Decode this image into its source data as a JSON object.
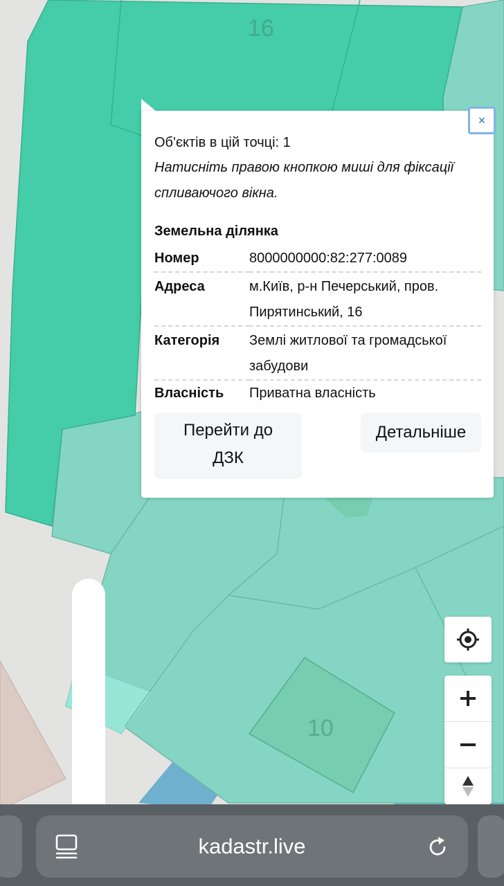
{
  "map": {
    "parcel_labels": [
      "16",
      "10"
    ]
  },
  "popup": {
    "close_label": "×",
    "objects_count": "Об'єктів в цій точці: 1",
    "hint": "Натисніть правою кнопкою миші для фіксації спливаючого вікна.",
    "section_title": "Земельна ділянка",
    "fields": [
      {
        "key": "Номер",
        "value": "8000000000:82:277:0089"
      },
      {
        "key": "Адреса",
        "value": "м.Київ, р-н Печерський, пров. Пирятинський, 16"
      },
      {
        "key": "Категорія",
        "value": "Землі житлової та громадської забудови"
      },
      {
        "key": "Власність",
        "value": "Приватна власність"
      }
    ],
    "btn_goto_dzk": "Перейти до ДЗК",
    "btn_details": "Детальніше"
  },
  "controls": {
    "locate_icon": "crosshair-icon",
    "zoom_in_icon": "plus-icon",
    "zoom_out_icon": "minus-icon",
    "compass_icon": "compass-icon"
  },
  "browser": {
    "url": "kadastr.live",
    "tabs_icon": "tabs-icon",
    "reload_icon": "reload-icon"
  },
  "colors": {
    "parcel_dark": "#45cca8",
    "parcel_light": "#85d5c4",
    "parcel_pale": "#98e6d8",
    "road": "#ffffff",
    "building_pink": "#dccbc3",
    "water_blue": "#6fb0cf",
    "accent_blue": "#2b6fc2"
  }
}
